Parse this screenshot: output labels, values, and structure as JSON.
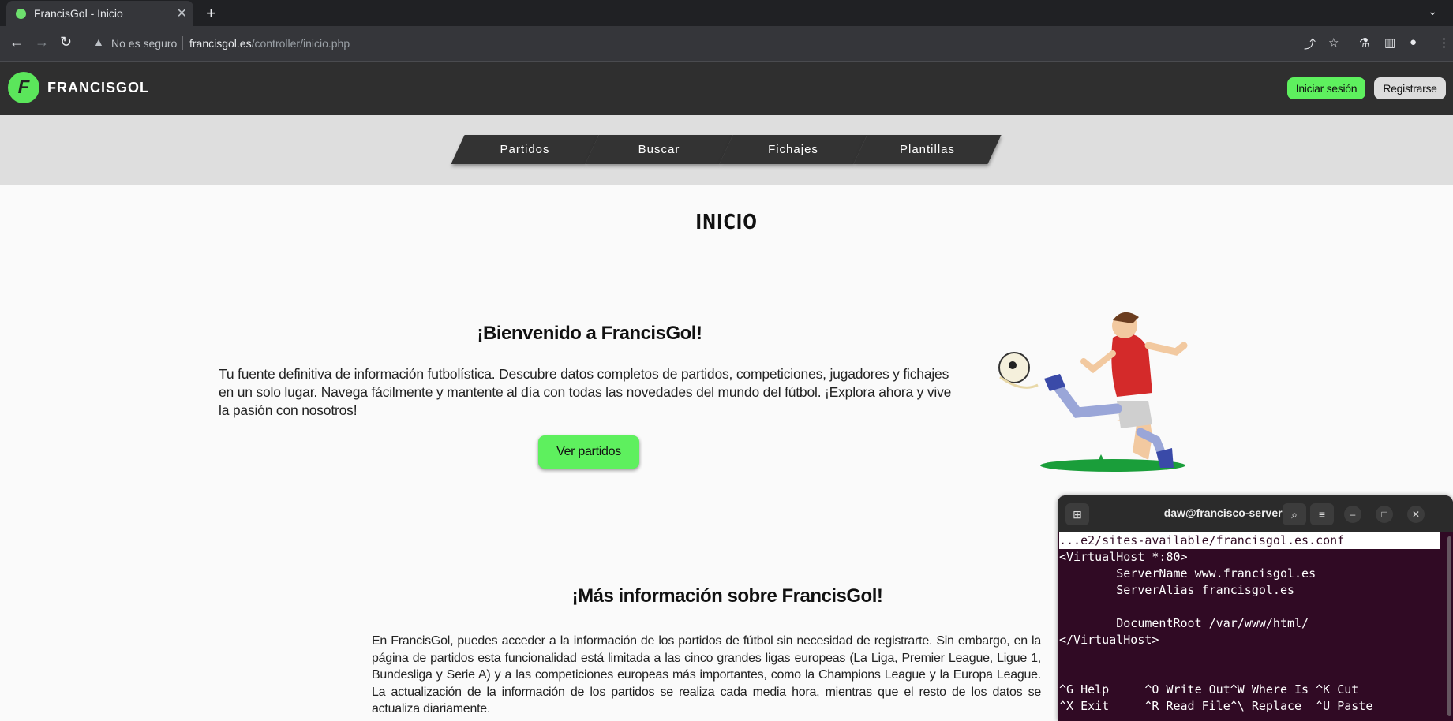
{
  "browser": {
    "tab_title": "FrancisGol - Inicio",
    "new_tab": "+",
    "security_label": "No es seguro",
    "url_host": "francisgol.es",
    "url_path": "/controller/inicio.php"
  },
  "site": {
    "brand": "FRANCISGOL",
    "logo_letter": "F",
    "login_label": "Iniciar sesión",
    "register_label": "Registrarse",
    "accent_color": "#5ef05e"
  },
  "nav": {
    "items": [
      "Partidos",
      "Buscar",
      "Fichajes",
      "Plantillas"
    ]
  },
  "page": {
    "title": "INICIO",
    "welcome_title": "¡Bienvenido a FrancisGol!",
    "welcome_text": "Tu fuente definitiva de información futbolística. Descubre datos completos de partidos, competiciones, jugadores y fichajes en un solo lugar. Navega fácilmente y mantente al día con todas las novedades del mundo del fútbol. ¡Explora ahora y vive la pasión con nosotros!",
    "ver_partidos": "Ver partidos",
    "more_title": "¡Más información sobre FrancisGol!",
    "more_text": "En FrancisGol, puedes acceder a la información de los partidos de fútbol sin necesidad de registrarte. Sin embargo, en la página de partidos esta funcionalidad está limitada a las cinco grandes ligas europeas (La Liga, Premier League, Ligue 1, Bundesliga y Serie A) y a las competiciones europeas más importantes, como la Champions League y la Europa League. La actualización de la información de los partidos se realiza cada media hora, mientras que el resto de los datos se actualiza diariamente."
  },
  "terminal": {
    "title": "daw@francisco-server: ~",
    "lines": [
      "...e2/sites-available/francisgol.es.conf",
      "<VirtualHost *:80>",
      "        ServerName www.francisgol.es",
      "        ServerAlias francisgol.es",
      "",
      "        DocumentRoot /var/www/html/",
      "</VirtualHost>",
      "",
      "",
      "^G Help     ^O Write Out^W Where Is ^K Cut",
      "^X Exit     ^R Read File^\\ Replace  ^U Paste"
    ]
  }
}
